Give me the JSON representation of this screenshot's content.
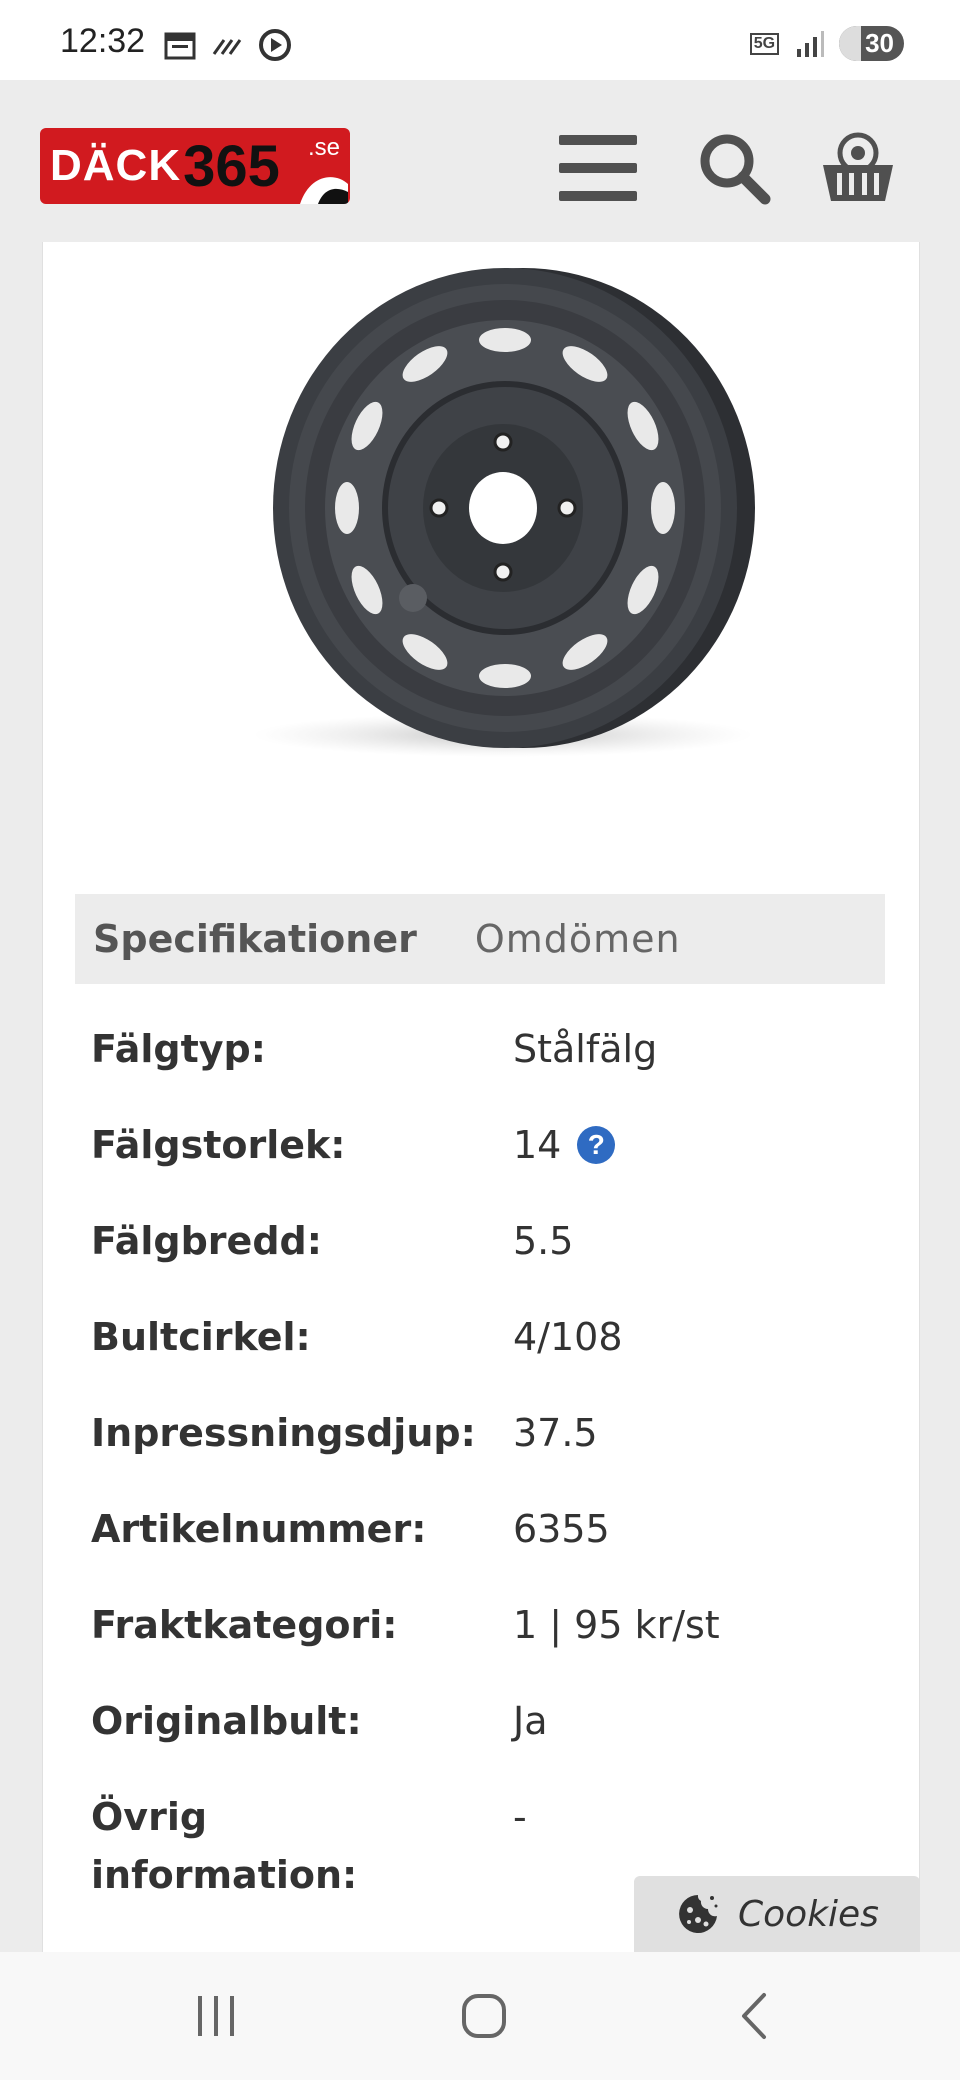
{
  "status_bar": {
    "time": "12:32",
    "network": "5G",
    "battery": "30"
  },
  "header": {
    "logo_text_main": "DÄCK",
    "logo_text_number": "365",
    "logo_text_domain": ".se",
    "icons": [
      "menu-icon",
      "search-icon",
      "basket-icon"
    ]
  },
  "product": {
    "image_alt": "steel-wheel-image"
  },
  "tabs": [
    {
      "label": "Specifikationer",
      "active": true
    },
    {
      "label": "Omdömen",
      "active": false
    }
  ],
  "specs": [
    {
      "label": "Fälgtyp:",
      "value": "Stålfälg"
    },
    {
      "label": "Fälgstorlek:",
      "value": "14"
    },
    {
      "label": "Fälgbredd:",
      "value": "5.5"
    },
    {
      "label": "Bultcirkel:",
      "value": "4/108"
    },
    {
      "label": "Inpressningsdjup:",
      "value": "37.5"
    },
    {
      "label": "Artikelnummer:",
      "value": "6355"
    },
    {
      "label": "Fraktkategori:",
      "value": "1 | 95 kr/st"
    },
    {
      "label": "Originalbult:",
      "value": "Ja"
    },
    {
      "label": "Övrig information:",
      "value": "-"
    }
  ],
  "help_icon_text": "?",
  "cookies": {
    "label": "Cookies"
  },
  "colors": {
    "brand_red": "#d11a1f",
    "help_blue": "#2f6bc2",
    "header_bg": "#ececec"
  }
}
